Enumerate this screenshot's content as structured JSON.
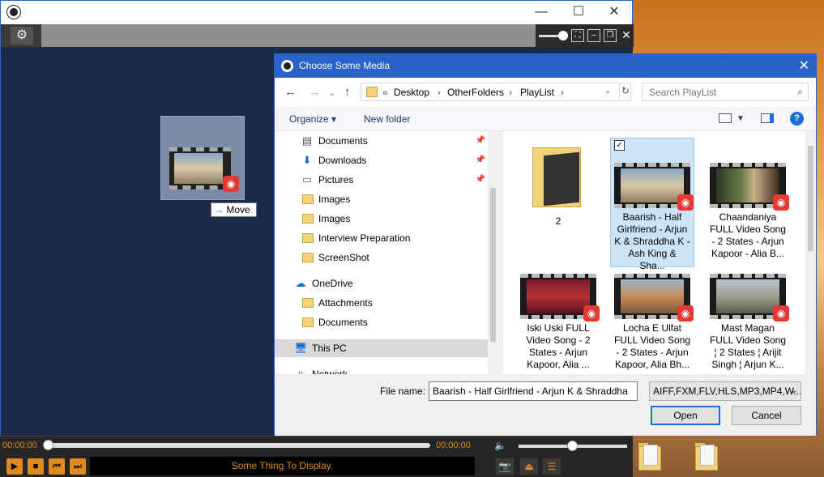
{
  "player": {
    "titlebar": {
      "minimize": "—",
      "maximize": "☐",
      "close": "✕"
    },
    "toolbar": {
      "settings_icon": "gear-icon"
    },
    "drag": {
      "tooltip": "Move"
    },
    "seek": {
      "time_start": "00:00:00",
      "time_end": "00:00:00",
      "progress": 0
    },
    "volume": {
      "level": 0.45
    },
    "display_text": "Some Thing To Display."
  },
  "dialog": {
    "title": "Choose Some Media",
    "breadcrumb": [
      "Desktop",
      "OtherFolders",
      "PlayList"
    ],
    "breadcrumb_prefix": "«",
    "search_placeholder": "Search PlayList",
    "organize": "Organize ▾",
    "new_folder": "New folder",
    "nav": {
      "quick": [
        {
          "label": "Documents",
          "icon": "documents-icon",
          "pinned": true
        },
        {
          "label": "Downloads",
          "icon": "download-icon",
          "pinned": true
        },
        {
          "label": "Pictures",
          "icon": "pictures-icon",
          "pinned": true
        },
        {
          "label": "Images",
          "icon": "folder-icon"
        },
        {
          "label": "Images",
          "icon": "folder-icon"
        },
        {
          "label": "Interview Preparation",
          "icon": "folder-icon"
        },
        {
          "label": "ScreenShot",
          "icon": "folder-icon"
        }
      ],
      "onedrive": "OneDrive",
      "onedrive_items": [
        "Attachments",
        "Documents"
      ],
      "this_pc": "This PC",
      "network": "Network"
    },
    "files": [
      {
        "name": "2",
        "type": "folder"
      },
      {
        "name": "Baarish - Half Girlfriend - Arjun K & Shraddha K - Ash King & Sha...",
        "type": "video",
        "selected": true
      },
      {
        "name": "Chaandaniya FULL Video Song - 2 States - Arjun Kapoor - Alia B...",
        "type": "video"
      },
      {
        "name": "Iski Uski FULL Video Song - 2 States - Arjun Kapoor, Alia ...",
        "type": "video"
      },
      {
        "name": "Locha E Ulfat FULL Video Song - 2 States - Arjun Kapoor, Alia Bh...",
        "type": "video"
      },
      {
        "name": "Mast Magan FULL Video Song ¦ 2 States ¦ Arijit Singh ¦ Arjun K...",
        "type": "video"
      }
    ],
    "file_name_label": "File name:",
    "file_name_value": "Baarish - Half Girlfriend - Arjun K & Shraddha",
    "file_types": "AIFF,FXM,FLV,HLS,MP3,MP4,W...",
    "open": "Open",
    "cancel": "Cancel"
  },
  "colors": {
    "accent": "#2a63c7",
    "player_orange": "#e08a1e",
    "selection": "#cce4f7"
  }
}
